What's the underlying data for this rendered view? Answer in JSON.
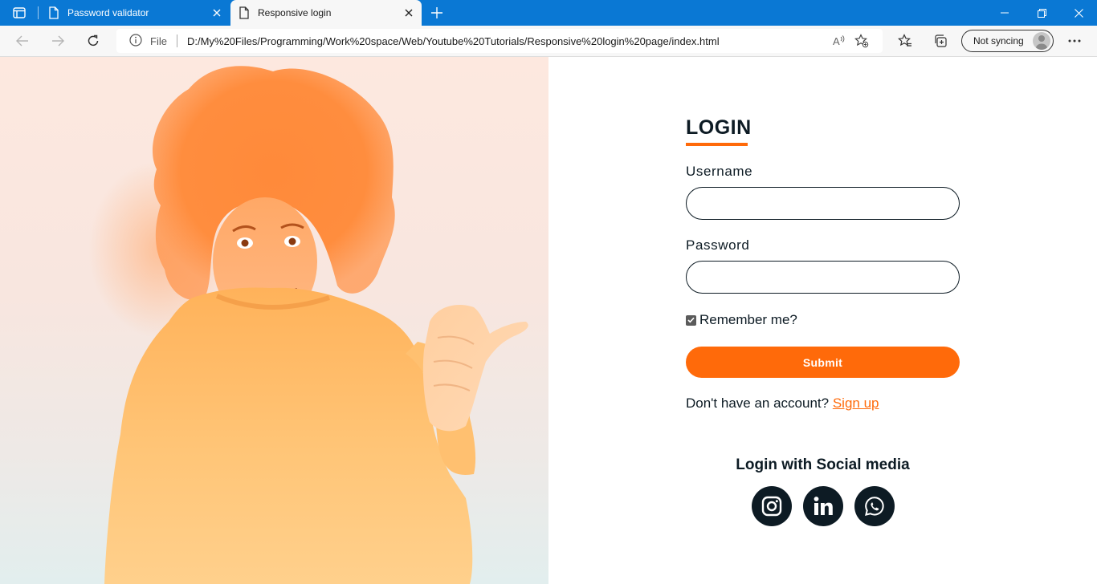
{
  "browser": {
    "tabs": [
      {
        "title": "Password validator",
        "active": false
      },
      {
        "title": "Responsive login",
        "active": true
      }
    ],
    "address": {
      "scheme_label": "File",
      "url": "D:/My%20Files/Programming/Work%20space/Web/Youtube%20Tutorials/Responsive%20login%20page/index.html"
    },
    "profile": {
      "label": "Not syncing"
    },
    "colors": {
      "titlebar": "#0a78d4",
      "toolbar": "#f7f7f7"
    }
  },
  "login": {
    "title": "LOGIN",
    "username_label": "Username",
    "username_value": "",
    "password_label": "Password",
    "password_value": "",
    "remember_label": "Remember me?",
    "remember_checked": true,
    "submit_label": "Submit",
    "signup_prompt": "Don't have an account?",
    "signup_link": "Sign up",
    "social_title": "Login with Social media",
    "social_icons": [
      "instagram-icon",
      "linkedin-icon",
      "whatsapp-icon"
    ]
  },
  "colors": {
    "accent": "#ff6a0a",
    "dark": "#0d1b24"
  }
}
